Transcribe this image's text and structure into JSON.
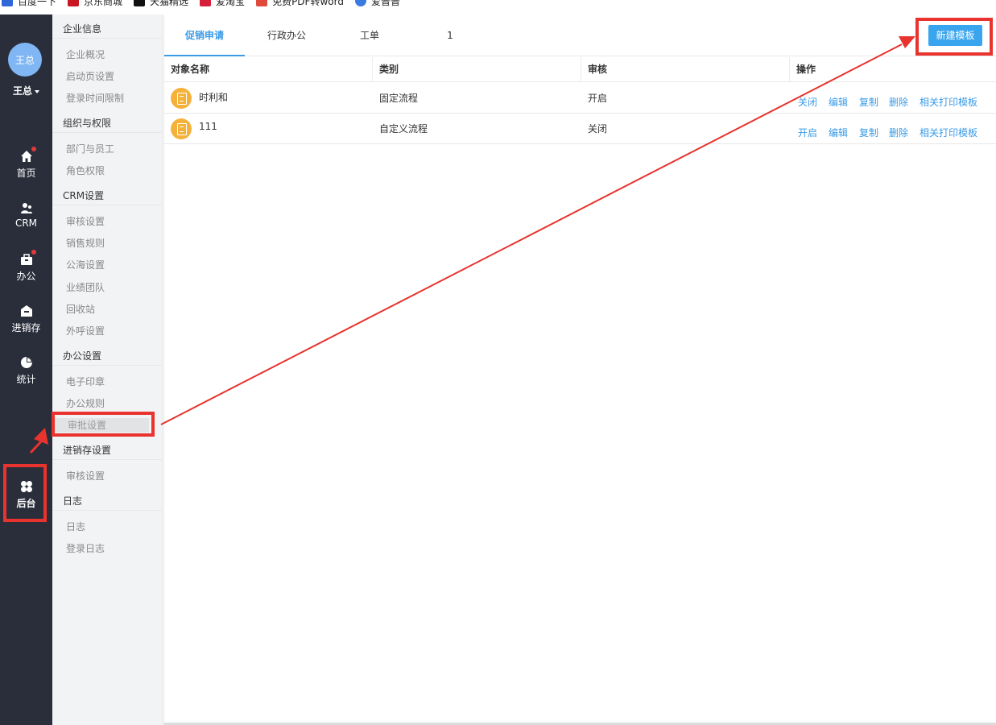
{
  "bookmarks": [
    "百度一下",
    "京东商城",
    "天猫精选",
    "爱淘宝",
    "免费PDF转word",
    "爱普普"
  ],
  "user": {
    "avatar_text": "王总",
    "name": "王总"
  },
  "nav": [
    {
      "label": "首页",
      "icon": "home-icon",
      "dot": true
    },
    {
      "label": "CRM",
      "icon": "crm-icon",
      "dot": false
    },
    {
      "label": "办公",
      "icon": "briefcase-icon",
      "dot": true
    },
    {
      "label": "进销存",
      "icon": "warehouse-icon",
      "dot": false
    },
    {
      "label": "统计",
      "icon": "pie-chart-icon",
      "dot": false
    },
    {
      "label": "后台",
      "icon": "clover-icon",
      "dot": false
    }
  ],
  "submenu": {
    "sections": [
      {
        "title": "企业信息",
        "items": [
          "企业概况",
          "启动页设置",
          "登录时间限制"
        ]
      },
      {
        "title": "组织与权限",
        "items": [
          "部门与员工",
          "角色权限"
        ]
      },
      {
        "title": "CRM设置",
        "items": [
          "审核设置",
          "销售规则",
          "公海设置",
          "业绩团队",
          "回收站",
          "外呼设置"
        ]
      },
      {
        "title": "办公设置",
        "items": [
          "电子印章",
          "办公规则",
          "审批设置"
        ]
      },
      {
        "title": "进销存设置",
        "items": [
          "审核设置"
        ]
      },
      {
        "title": "日志",
        "items": [
          "日志",
          "登录日志"
        ]
      }
    ],
    "active": "审批设置"
  },
  "tabs": [
    "促销申请",
    "行政办公",
    "工单",
    "1"
  ],
  "active_tab": "促销申请",
  "new_button": "新建模板",
  "table": {
    "headers": [
      "对象名称",
      "类别",
      "审核",
      "操作"
    ],
    "rows": [
      {
        "name": "时利和",
        "category": "固定流程",
        "audit": "开启",
        "ops": [
          "关闭",
          "编辑",
          "复制",
          "删除",
          "相关打印模板"
        ]
      },
      {
        "name": "111",
        "category": "自定义流程",
        "audit": "关闭",
        "ops": [
          "开启",
          "编辑",
          "复制",
          "删除",
          "相关打印模板"
        ]
      }
    ]
  },
  "colors": {
    "accent": "#3a9be6",
    "annotation": "#e8332e",
    "nav_bg": "#2a2e3b"
  }
}
